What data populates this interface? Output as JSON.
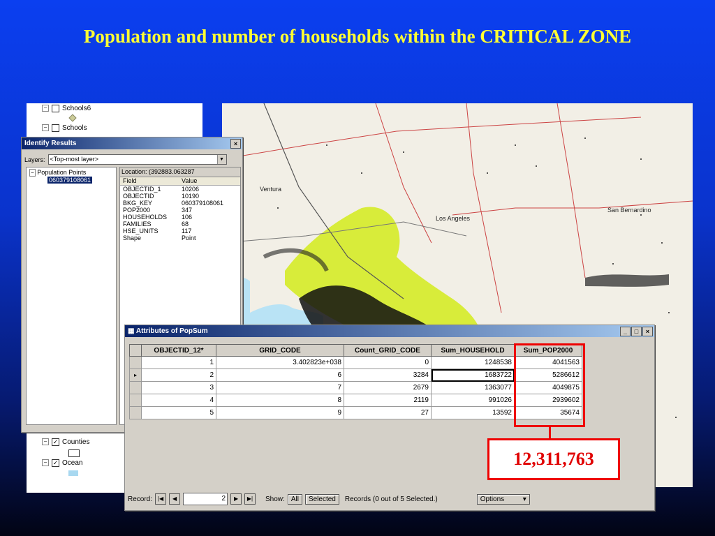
{
  "slide": {
    "title": "Population and number of households within the CRITICAL ZONE"
  },
  "toc": {
    "layers": [
      {
        "name": "Schools6",
        "checked": false
      },
      {
        "name": "Schools",
        "checked": false
      },
      {
        "name": "Counties",
        "checked": true
      },
      {
        "name": "Ocean",
        "checked": true
      }
    ]
  },
  "map": {
    "places": [
      "Ventura",
      "Los Angeles",
      "San Bernardino"
    ]
  },
  "identify": {
    "title": "Identify Results",
    "layers_label": "Layers:",
    "layers_value": "<Top-most layer>",
    "tree_root": "Population Points",
    "tree_item": "060379108061",
    "location": "Location: (392883.063287",
    "field_header": "Field",
    "value_header": "Value",
    "rows": [
      {
        "field": "OBJECTID_1",
        "value": "10206"
      },
      {
        "field": "OBJECTID",
        "value": "10190"
      },
      {
        "field": "BKG_KEY",
        "value": "060379108061"
      },
      {
        "field": "POP2000",
        "value": "347"
      },
      {
        "field": "HOUSEHOLDS",
        "value": "106"
      },
      {
        "field": "FAMILIES",
        "value": "68"
      },
      {
        "field": "HSE_UNITS",
        "value": "117"
      },
      {
        "field": "Shape",
        "value": "Point"
      }
    ]
  },
  "attributes": {
    "title": "Attributes of PopSum",
    "columns": [
      "OBJECTID_12*",
      "GRID_CODE",
      "Count_GRID_CODE",
      "Sum_HOUSEHOLD",
      "Sum_POP2000"
    ],
    "rows": [
      [
        "1",
        "3.402823e+038",
        "0",
        "1248538",
        "4041563"
      ],
      [
        "2",
        "6",
        "3284",
        "1683722",
        "5286612"
      ],
      [
        "3",
        "7",
        "2679",
        "1363077",
        "4049875"
      ],
      [
        "4",
        "8",
        "2119",
        "991026",
        "2939602"
      ],
      [
        "5",
        "9",
        "27",
        "13592",
        "35674"
      ]
    ],
    "record_label": "Record:",
    "record_value": "2",
    "show_label": "Show:",
    "all_label": "All",
    "selected_label": "Selected",
    "records_text": "Records (0 out of 5 Selected.)",
    "options_label": "Options"
  },
  "annotation": {
    "total": "12,311,763"
  },
  "colors": {
    "title": "#ffff33",
    "annotation": "#ee0000",
    "critical_zone": "#d8ec3a"
  }
}
